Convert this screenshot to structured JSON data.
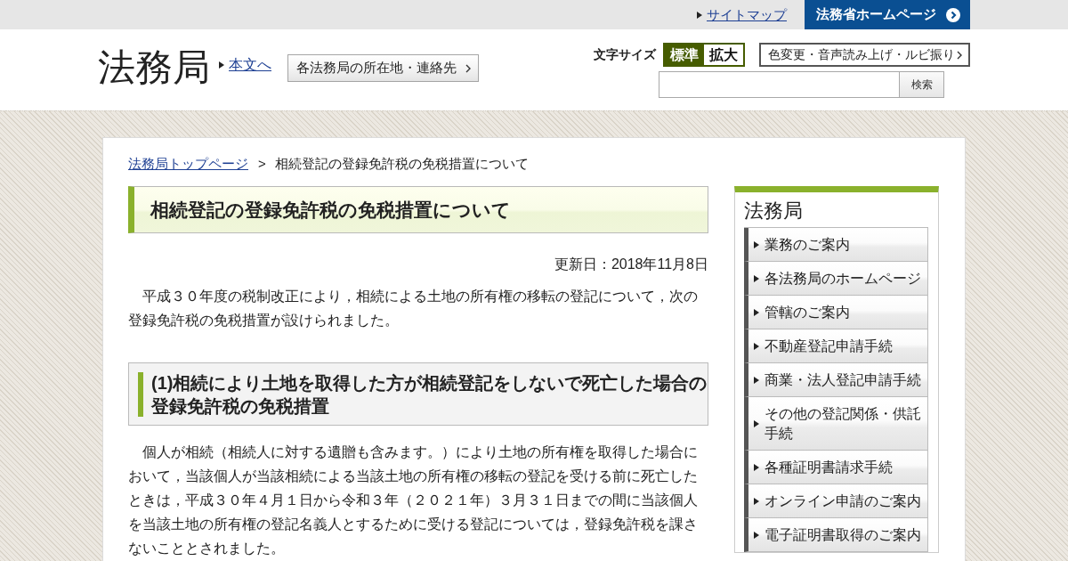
{
  "top_bar": {
    "sitemap_link": "サイトマップ",
    "home_button": "法務省ホームページ"
  },
  "header": {
    "logo": "法務局",
    "skip_link": "本文へ",
    "offices_button": "各法務局の所在地・連絡先",
    "font_size": {
      "label": "文字サイズ",
      "options": [
        {
          "label": "標準",
          "selected": true
        },
        {
          "label": "拡大",
          "selected": false
        }
      ]
    },
    "accessibility_button": "色変更・音声読み上げ・ルビ振り",
    "search": {
      "button": "検索"
    }
  },
  "breadcrumb": {
    "separator": ">",
    "items": [
      {
        "kind": "link",
        "label": "法務局トップページ"
      },
      {
        "kind": "current",
        "label": "相続登記の登録免許税の免税措置について"
      }
    ]
  },
  "article": {
    "title": "相続登記の登録免許税の免税措置について",
    "updated": "更新日：2018年11月8日",
    "blocks": [
      {
        "kind": "paragraph",
        "text": "平成３０年度の税制改正により，相続による土地の所有権の移転の登記について，次の登録免許税の免税措置が設けられました。"
      },
      {
        "kind": "heading",
        "text": "(1)相続により土地を取得した方が相続登記をしないで死亡した場合の登録免許税の免税措置"
      },
      {
        "kind": "paragraph",
        "text": "個人が相続（相続人に対する遺贈も含みます。）により土地の所有権を取得した場合において，当該個人が当該相続による当該土地の所有権の移転の登記を受ける前に死亡したときは，平成３０年４月１日から令和３年（２０２１年）３月３１日までの間に当該個人を当該土地の所有権の登記名義人とするために受ける登記については，登録免許税を課さないこととされました。"
      }
    ]
  },
  "sidebar": {
    "title": "法務局",
    "items": [
      "業務のご案内",
      "各法務局のホームページ",
      "管轄のご案内",
      "不動産登記申請手続",
      "商業・法人登記申請手続",
      "その他の登記関係・供託手続",
      "各種証明書請求手続",
      "オンライン申請のご案内",
      "電子証明書取得のご案内"
    ]
  }
}
